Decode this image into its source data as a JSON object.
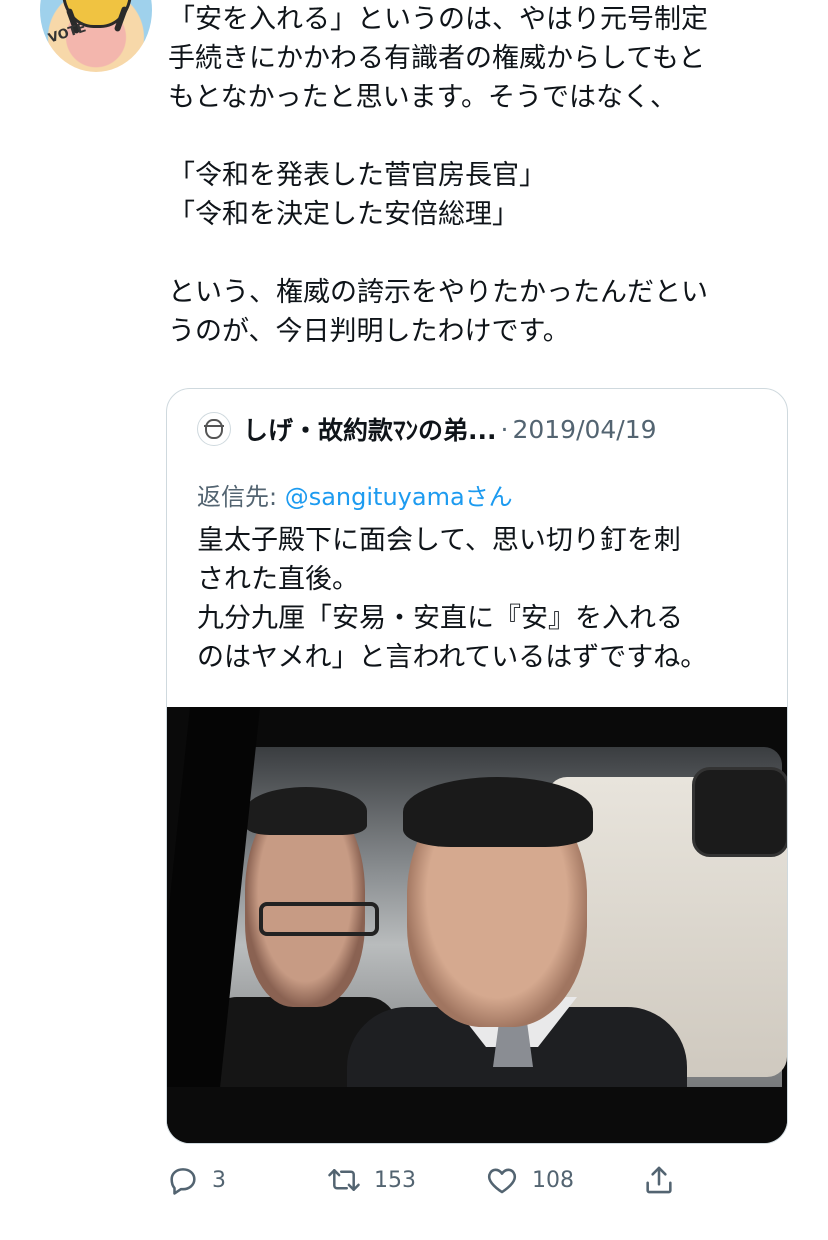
{
  "tweet": {
    "text": "「安を入れる」というのは、やはり元号制定\n手続きにかかわる有識者の権威からしてもと\nもとなかったと思います。そうではなく、\n\n「令和を発表した菅官房長官」\n「令和を決定した安倍総理」\n\nという、権威の誇示をやりたかったんだとい\nうのが、今日判明したわけです。",
    "avatar_badge": "VOTE"
  },
  "quote": {
    "author_name": "しげ・故約款ﾏﾝの弟...",
    "separator": "·",
    "date": "2019/04/19",
    "reply_prefix": "返信先: ",
    "reply_mention": "@sangituyama",
    "reply_suffix": "さん",
    "body": "皇太子殿下に面会して、思い切り釘を刺\nされた直後。\n九分九厘「安易・安直に『安』を入れる\nのはヤメれ」と言われているはずですね。"
  },
  "actions": {
    "reply_count": "3",
    "retweet_count": "153",
    "like_count": "108"
  },
  "colors": {
    "text": "#0f1419",
    "secondary": "#536471",
    "link": "#1d9bf0",
    "border": "#cfd9de"
  }
}
